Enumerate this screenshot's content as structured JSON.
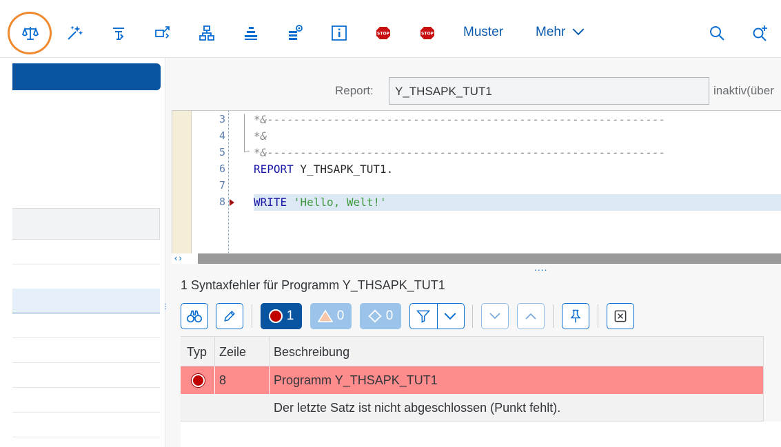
{
  "toolbar": {
    "muster_label": "Muster",
    "mehr_label": "Mehr",
    "stop_text": "STOP",
    "icons": [
      "balance-scale-icon",
      "magic-wand-icon",
      "activate-icon",
      "navigate-icon",
      "hierarchy-icon",
      "object-list-icon",
      "database-view-icon",
      "info-icon",
      "stop-breakpoint-icon",
      "stop-session-breakpoint-icon",
      "chevron-down-icon",
      "search-icon",
      "search-plus-icon"
    ]
  },
  "report": {
    "label": "Report:",
    "value": "Y_THSAPK_TUT1",
    "status": "inaktiv(über"
  },
  "editor": {
    "lines": [
      {
        "num": "3",
        "text": "*&------------------------------------------------------------"
      },
      {
        "num": "4",
        "text": "*&"
      },
      {
        "num": "5",
        "text": "*&------------------------------------------------------------"
      },
      {
        "num": "6",
        "keyword": "REPORT",
        "rest": " Y_THSAPK_TUT1."
      },
      {
        "num": "7",
        "text": ""
      },
      {
        "num": "8",
        "keyword": "WRITE",
        "string": " 'Hello, Welt!'"
      }
    ]
  },
  "messages": {
    "title": "1 Syntaxfehler für Programm Y_THSAPK_TUT1",
    "error_count": "1",
    "warning_count": "0",
    "info_count": "0",
    "columns": [
      "Typ",
      "Zeile",
      "Beschreibung"
    ],
    "rows": [
      {
        "line": "8",
        "description": "Programm Y_THSAPK_TUT1",
        "detail": "Der letzte Satz ist nicht abgeschlossen (Punkt fehlt)."
      }
    ]
  },
  "colors": {
    "accent": "#0a6ed1",
    "brand_dark": "#0854a0",
    "error_row": "#ff8c8c",
    "highlight_ring": "#f08a30"
  }
}
